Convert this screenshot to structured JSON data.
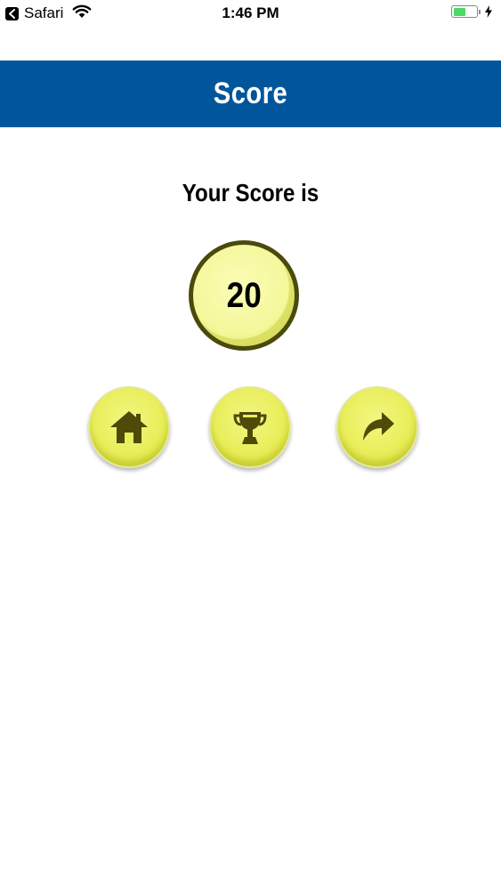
{
  "status_bar": {
    "app": "Safari",
    "time": "1:46 PM",
    "battery_level": 0.55,
    "icons": {
      "back": "back-arrow-icon",
      "wifi": "wifi-icon",
      "battery": "battery-icon",
      "charging": "charging-bolt-icon"
    }
  },
  "header": {
    "title": "Score"
  },
  "score": {
    "label": "Your Score is",
    "value": "20"
  },
  "buttons": [
    {
      "icon": "home-icon"
    },
    {
      "icon": "trophy-icon"
    },
    {
      "icon": "share-arrow-icon"
    }
  ],
  "colors": {
    "header_bg": "#01559b",
    "header_text": "#ffffff",
    "button_yellow": "#e8ee5a",
    "icon_dark": "#4d4b07",
    "score_ring": "#4a4a0c"
  }
}
